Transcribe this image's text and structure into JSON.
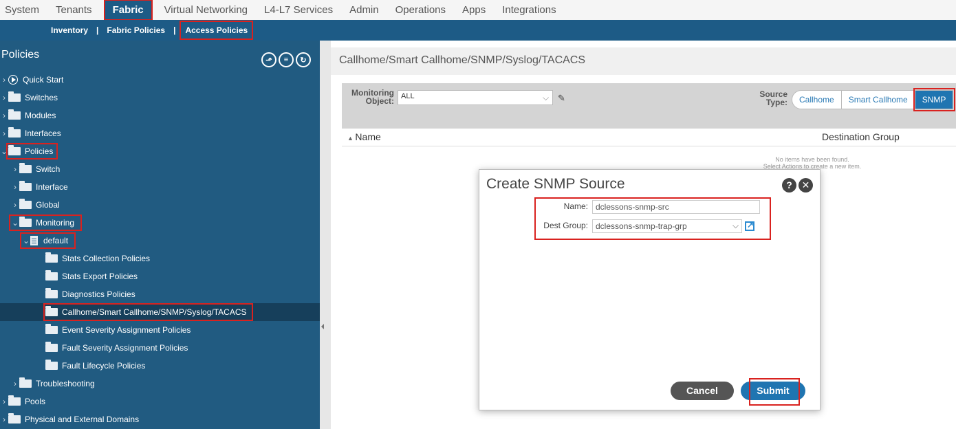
{
  "topnav": [
    "System",
    "Tenants",
    "Fabric",
    "Virtual Networking",
    "L4-L7 Services",
    "Admin",
    "Operations",
    "Apps",
    "Integrations"
  ],
  "subnav": {
    "inventory": "Inventory",
    "fabric_policies": "Fabric Policies",
    "access_policies": "Access Policies",
    "separator": "|"
  },
  "sidebar": {
    "title": "Policies",
    "items": [
      "Quick Start",
      "Switches",
      "Modules",
      "Interfaces",
      "Policies",
      "Switch",
      "Interface",
      "Global",
      "Monitoring",
      "default",
      "Stats Collection Policies",
      "Stats Export Policies",
      "Diagnostics Policies",
      "Callhome/Smart Callhome/SNMP/Syslog/TACACS",
      "Event Severity Assignment Policies",
      "Fault Severity Assignment Policies",
      "Fault Lifecycle Policies",
      "Troubleshooting",
      "Pools",
      "Physical and External Domains"
    ]
  },
  "main": {
    "title": "Callhome/Smart Callhome/SNMP/Syslog/TACACS",
    "monitoring_object_label1": "Monitoring",
    "monitoring_object_label2": "Object:",
    "monitoring_object_value": "ALL",
    "source_type_label1": "Source",
    "source_type_label2": "Type:",
    "source_types": [
      "Callhome",
      "Smart Callhome",
      "SNMP"
    ],
    "col_name": "Name",
    "col_dest": "Destination Group",
    "empty_line1": "No items have been found.",
    "empty_line2": "Select Actions to create a new item."
  },
  "dialog": {
    "title": "Create SNMP Source",
    "name_label": "Name:",
    "name_value": "dclessons-snmp-src",
    "dest_label": "Dest Group:",
    "dest_value": "dclessons-snmp-trap-grp",
    "cancel": "Cancel",
    "submit": "Submit"
  },
  "colors": {
    "nav_dark": "#1d5b86",
    "sidebar": "#215b81",
    "accent": "#1f75b1",
    "highlight": "#d9221f"
  }
}
